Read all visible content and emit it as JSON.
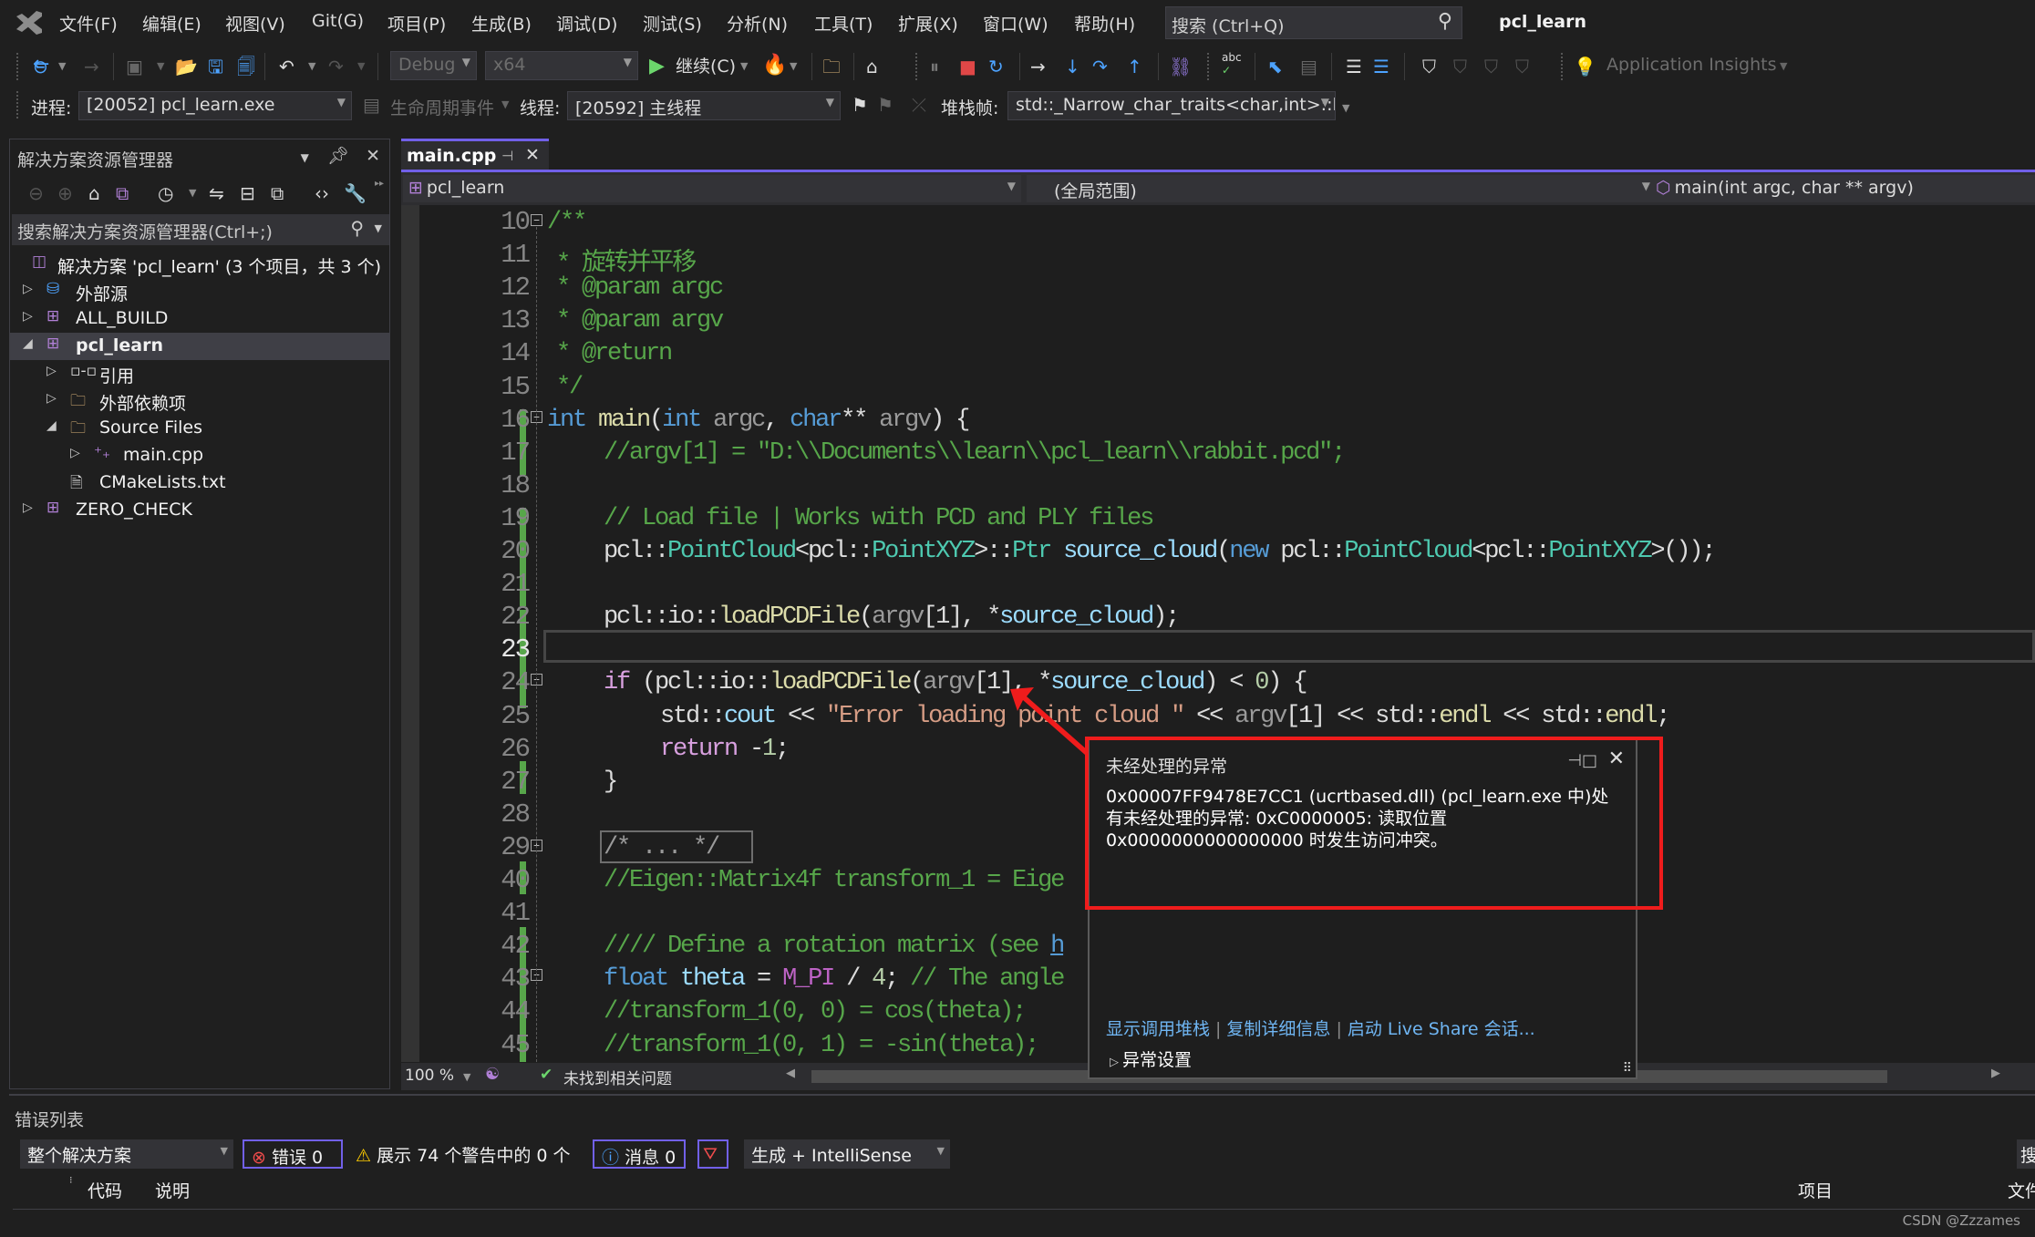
{
  "app": {
    "solution_title": "pcl_learn",
    "menu": [
      "文件(F)",
      "编辑(E)",
      "视图(V)",
      "Git(G)",
      "项目(P)",
      "生成(B)",
      "调试(D)",
      "测试(S)",
      "分析(N)",
      "工具(T)",
      "扩展(X)",
      "窗口(W)",
      "帮助(H)"
    ],
    "search_placeholder": "搜索 (Ctrl+Q)"
  },
  "toolbar": {
    "config": "Debug",
    "platform": "x64",
    "continue_label": "继续(C)",
    "app_insights": "Application Insights"
  },
  "debug_location": {
    "process_label": "进程:",
    "process_value": "[20052] pcl_learn.exe",
    "lifecycle_label": "生命周期事件",
    "thread_label": "线程:",
    "thread_value": "[20592] 主线程",
    "stack_label": "堆栈帧:",
    "stack_value": "std::_Narrow_char_traits<char,int>::l"
  },
  "solution_explorer": {
    "title": "解决方案资源管理器",
    "search_placeholder": "搜索解决方案资源管理器(Ctrl+;)",
    "items": [
      {
        "label": "解决方案 'pcl_learn' (3 个项目，共 3 个)",
        "icon": "solution-icon",
        "depth": 0,
        "expander": "none"
      },
      {
        "label": "外部源",
        "icon": "external-sources-icon",
        "depth": 0,
        "expander": "collapsed"
      },
      {
        "label": "ALL_BUILD",
        "icon": "cpp-project-icon",
        "depth": 0,
        "expander": "collapsed"
      },
      {
        "label": "pcl_learn",
        "icon": "cpp-project-icon",
        "depth": 0,
        "expander": "expanded",
        "selected": true
      },
      {
        "label": "引用",
        "icon": "references-icon",
        "depth": 1,
        "expander": "collapsed"
      },
      {
        "label": "外部依赖项",
        "icon": "external-deps-icon",
        "depth": 1,
        "expander": "collapsed"
      },
      {
        "label": "Source Files",
        "icon": "filter-folder-icon",
        "depth": 1,
        "expander": "expanded"
      },
      {
        "label": "main.cpp",
        "icon": "cpp-file-icon",
        "depth": 2,
        "expander": "collapsed"
      },
      {
        "label": "CMakeLists.txt",
        "icon": "text-file-icon",
        "depth": 1,
        "expander": "none"
      },
      {
        "label": "ZERO_CHECK",
        "icon": "cpp-project-icon",
        "depth": 0,
        "expander": "collapsed"
      }
    ]
  },
  "editor": {
    "tab_label": "main.cpp",
    "nav_project": "pcl_learn",
    "nav_scope": "(全局范围)",
    "nav_member": "main(int argc, char ** argv)",
    "current_line": 23,
    "lines": [
      {
        "n": "10",
        "text": "/**"
      },
      {
        "n": "11",
        "text": "* 旋转并平移"
      },
      {
        "n": "12",
        "text": "* @param argc"
      },
      {
        "n": "13",
        "text": "* @param argv"
      },
      {
        "n": "14",
        "text": "* @return"
      },
      {
        "n": "15",
        "text": "*/"
      },
      {
        "n": "16",
        "text": "int main(int argc, char** argv) {"
      },
      {
        "n": "17",
        "text": "//argv[1] = \"D:\\\\Documents\\\\learn\\\\pcl_learn\\\\rabbit.pcd\";"
      },
      {
        "n": "18",
        "text": ""
      },
      {
        "n": "19",
        "text": "// Load file | Works with PCD and PLY files"
      },
      {
        "n": "20",
        "text": "pcl::PointCloud<pcl::PointXYZ>::Ptr source_cloud(new pcl::PointCloud<pcl::PointXYZ>());"
      },
      {
        "n": "21",
        "text": ""
      },
      {
        "n": "22",
        "text": "pcl::io::loadPCDFile(argv[1], *source_cloud);"
      },
      {
        "n": "23",
        "text": ""
      },
      {
        "n": "24",
        "text": "if (pcl::io::loadPCDFile(argv[1], *source_cloud) < 0) {"
      },
      {
        "n": "25",
        "text": "std::cout << \"Error loading point cloud \" << argv[1] << std::endl << std::endl;"
      },
      {
        "n": "26",
        "text": "return -1;"
      },
      {
        "n": "27",
        "text": "}"
      },
      {
        "n": "28",
        "text": ""
      },
      {
        "n": "29",
        "text": "/* ... */"
      },
      {
        "n": "40",
        "text": "//Eigen::Matrix4f transform_1 = Eige"
      },
      {
        "n": "41",
        "text": ""
      },
      {
        "n": "42",
        "text": "//// Define a rotation matrix (see h ... trix)"
      },
      {
        "n": "43",
        "text": "float theta = M_PI / 4; // The angle"
      },
      {
        "n": "44",
        "text": "//transform_1(0, 0) = cos(theta);"
      },
      {
        "n": "45",
        "text": "//transform_1(0, 1) = -sin(theta);"
      }
    ],
    "zoom": "100 %",
    "issues_status": "未找到相关问题"
  },
  "exception": {
    "title": "未经处理的异常",
    "message": "0x00007FF9478E7CC1 (ucrtbased.dll) (pcl_learn.exe 中)处有未经处理的异常: 0xC0000005: 读取位置 0x0000000000000000 时发生访问冲突。",
    "links": [
      "显示调用堆栈",
      "复制详细信息",
      "启动 Live Share 会话..."
    ],
    "settings_label": "异常设置",
    "annotation_color": "#ef1c1c"
  },
  "error_list": {
    "title": "错误列表",
    "scope": "整个解决方案",
    "errors": "错误 0",
    "warnings": "展示 74 个警告中的 0 个",
    "messages": "消息 0",
    "source": "生成 + IntelliSense",
    "search_stub": "搜",
    "columns": [
      "代码",
      "说明",
      "项目",
      "文件"
    ]
  },
  "watermark": "CSDN @Zzzames"
}
